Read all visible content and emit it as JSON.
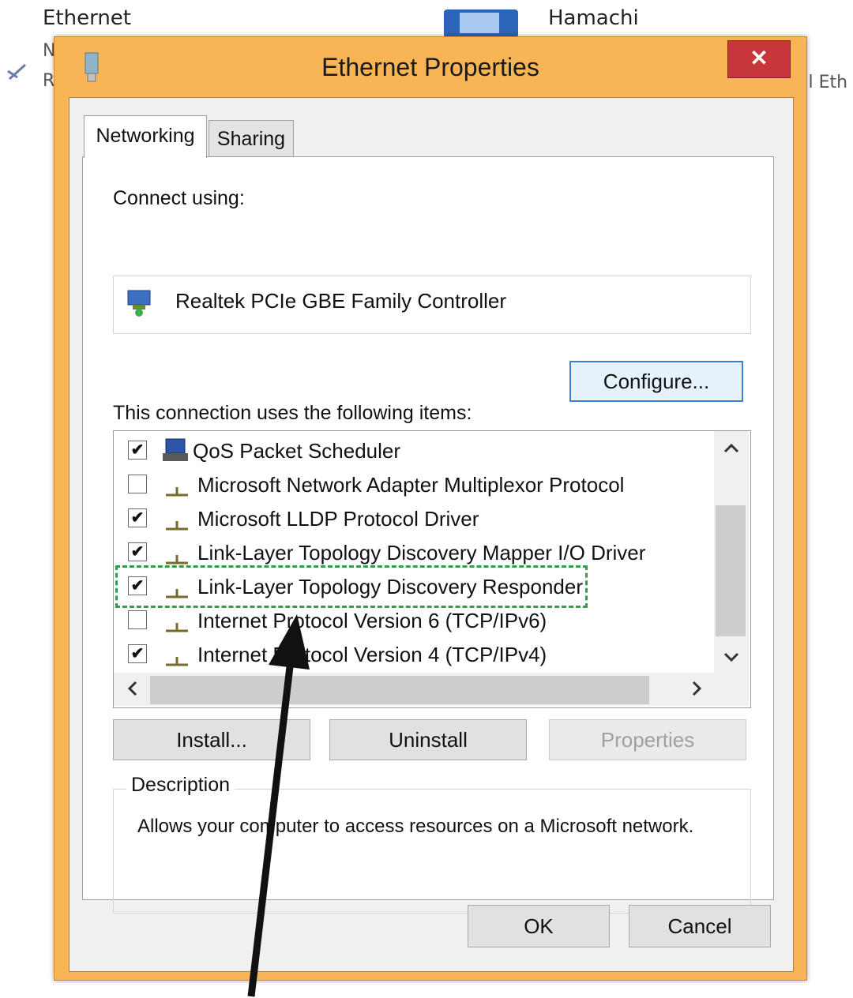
{
  "background": {
    "left_item": {
      "name": "Ethernet",
      "line2": "N",
      "line3": "R"
    },
    "right_item": {
      "name": "Hamachi",
      "right_clip": "al Eth"
    }
  },
  "dialog": {
    "title": "Ethernet Properties",
    "close_label": "✕",
    "tabs": [
      {
        "label": "Networking",
        "active": true
      },
      {
        "label": "Sharing",
        "active": false
      }
    ],
    "connect_using_label": "Connect using:",
    "adapter_name": "Realtek PCIe GBE Family Controller",
    "configure_label": "Configure...",
    "items_label": "This connection uses the following items:",
    "items": [
      {
        "label": "QoS Packet Scheduler",
        "checked": true,
        "icon": "qos-icon"
      },
      {
        "label": "Microsoft Network Adapter Multiplexor Protocol",
        "checked": false,
        "icon": "protocol-icon"
      },
      {
        "label": "Microsoft LLDP Protocol Driver",
        "checked": true,
        "icon": "protocol-icon"
      },
      {
        "label": "Link-Layer Topology Discovery Mapper I/O Driver",
        "checked": true,
        "icon": "protocol-icon"
      },
      {
        "label": "Link-Layer Topology Discovery Responder",
        "checked": true,
        "icon": "protocol-icon"
      },
      {
        "label": "Internet Protocol Version 6 (TCP/IPv6)",
        "checked": false,
        "icon": "protocol-icon"
      },
      {
        "label": "Internet Protocol Version 4 (TCP/IPv4)",
        "checked": true,
        "icon": "protocol-icon"
      }
    ],
    "install_label": "Install...",
    "uninstall_label": "Uninstall",
    "properties_label": "Properties",
    "description_legend": "Description",
    "description_text": "Allows your computer to access resources on a Microsoft network.",
    "ok_label": "OK",
    "cancel_label": "Cancel"
  },
  "colors": {
    "frame": "#f7b556",
    "close": "#c7363a",
    "highlight": "#3a9a4a",
    "focus": "#3c7fd6"
  }
}
